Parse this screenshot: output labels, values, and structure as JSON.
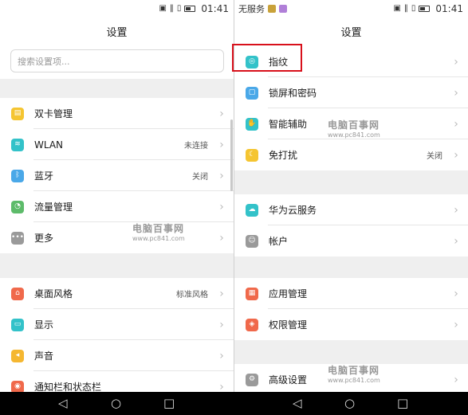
{
  "status_left": {
    "time": "01:41"
  },
  "status_right": {
    "carrier": "无服务",
    "time": "01:41"
  },
  "left": {
    "title": "设置",
    "search_placeholder": "搜索设置项...",
    "items": [
      {
        "label": "双卡管理",
        "value": "",
        "icon": "sim-card-icon",
        "color": "#f5c531"
      },
      {
        "label": "WLAN",
        "value": "未连接",
        "icon": "wifi-icon",
        "color": "#33c2c9"
      },
      {
        "label": "蓝牙",
        "value": "关闭",
        "icon": "bluetooth-icon",
        "color": "#4aa8e8"
      },
      {
        "label": "流量管理",
        "value": "",
        "icon": "data-usage-icon",
        "color": "#5dbb6a"
      },
      {
        "label": "更多",
        "value": "",
        "icon": "more-icon",
        "color": "#9a9a9a"
      },
      {
        "label": "桌面风格",
        "value": "标准风格",
        "icon": "home-style-icon",
        "color": "#f0694b"
      },
      {
        "label": "显示",
        "value": "",
        "icon": "display-icon",
        "color": "#33c2c9"
      },
      {
        "label": "声音",
        "value": "",
        "icon": "sound-icon",
        "color": "#f5b731"
      },
      {
        "label": "通知栏和状态栏",
        "value": "",
        "icon": "notification-icon",
        "color": "#f0694b"
      }
    ]
  },
  "right": {
    "title": "设置",
    "items": [
      {
        "label": "指纹",
        "value": "",
        "icon": "fingerprint-icon",
        "color": "#33c2c9"
      },
      {
        "label": "锁屏和密码",
        "value": "",
        "icon": "lock-icon",
        "color": "#4aa8e8"
      },
      {
        "label": "智能辅助",
        "value": "",
        "icon": "hand-icon",
        "color": "#33c2c9"
      },
      {
        "label": "免打扰",
        "value": "关闭",
        "icon": "moon-icon",
        "color": "#f5c531"
      },
      {
        "label": "华为云服务",
        "value": "",
        "icon": "cloud-icon",
        "color": "#33c2c9"
      },
      {
        "label": "帐户",
        "value": "",
        "icon": "account-icon",
        "color": "#9a9a9a"
      },
      {
        "label": "应用管理",
        "value": "",
        "icon": "apps-icon",
        "color": "#f0694b"
      },
      {
        "label": "权限管理",
        "value": "",
        "icon": "permission-icon",
        "color": "#f0694b"
      },
      {
        "label": "高级设置",
        "value": "",
        "icon": "advanced-settings-icon",
        "color": "#9a9a9a"
      }
    ]
  },
  "watermarks": [
    {
      "main": "电脑百事网",
      "sub": "www.pc841.com"
    },
    {
      "main": "电脑百事网",
      "sub": "www.pc841.com"
    },
    {
      "main": "电脑百事网",
      "sub": "www.pc841.com"
    }
  ],
  "colors": {
    "highlight": "#d8101b",
    "navbar": "#000000"
  }
}
